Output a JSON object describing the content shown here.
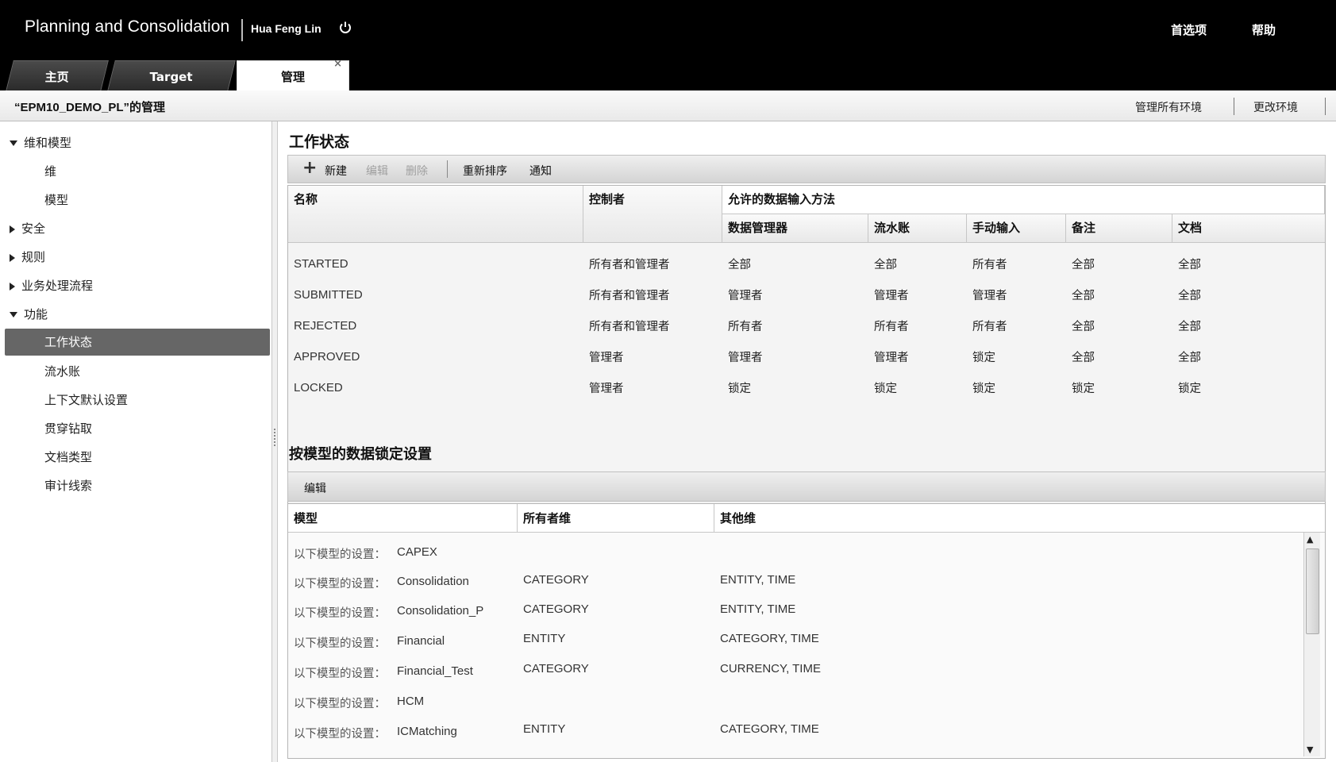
{
  "header": {
    "app_title": "Planning and Consolidation",
    "user": "Hua Feng Lin",
    "links": [
      "首选项",
      "帮助"
    ]
  },
  "tabs": [
    {
      "label": "主页",
      "active": false
    },
    {
      "label": "Target",
      "active": false
    },
    {
      "label": "管理",
      "active": true,
      "close": "×"
    }
  ],
  "subbar": {
    "title": "“EPM10_DEMO_PL”的管理",
    "links": [
      "管理所有环境",
      "更改环境"
    ]
  },
  "sidebar": {
    "items": [
      {
        "label": "维和模型",
        "expand": "down",
        "level": 0
      },
      {
        "label": "维",
        "level": 1
      },
      {
        "label": "模型",
        "level": 1
      },
      {
        "label": "安全",
        "expand": "right",
        "level": 0
      },
      {
        "label": "规则",
        "expand": "right",
        "level": 0
      },
      {
        "label": "业务处理流程",
        "expand": "right",
        "level": 0
      },
      {
        "label": "功能",
        "expand": "down",
        "level": 0
      },
      {
        "label": "工作状态",
        "level": 1,
        "selected": true
      },
      {
        "label": "流水账",
        "level": 1
      },
      {
        "label": "上下文默认设置",
        "level": 1
      },
      {
        "label": "贯穿钻取",
        "level": 1
      },
      {
        "label": "文档类型",
        "level": 1
      },
      {
        "label": "审计线索",
        "level": 1
      }
    ]
  },
  "work_status": {
    "title": "工作状态",
    "toolbar": {
      "new": "新建",
      "edit": "编辑",
      "delete": "删除",
      "reorder": "重新排序",
      "notify": "通知"
    },
    "headers": {
      "name": "名称",
      "controller": "控制者",
      "allowed_methods": "允许的数据输入方法",
      "sub": [
        "数据管理器",
        "流水账",
        "手动输入",
        "备注",
        "文档"
      ]
    },
    "rows": [
      {
        "name": "STARTED",
        "controller": "所有者和管理者",
        "values": [
          "全部",
          "全部",
          "所有者",
          "全部",
          "全部"
        ]
      },
      {
        "name": "SUBMITTED",
        "controller": "所有者和管理者",
        "values": [
          "管理者",
          "管理者",
          "管理者",
          "全部",
          "全部"
        ]
      },
      {
        "name": "REJECTED",
        "controller": "所有者和管理者",
        "values": [
          "所有者",
          "所有者",
          "所有者",
          "全部",
          "全部"
        ]
      },
      {
        "name": "APPROVED",
        "controller": "管理者",
        "values": [
          "管理者",
          "管理者",
          "锁定",
          "全部",
          "全部"
        ]
      },
      {
        "name": "LOCKED",
        "controller": "管理者",
        "values": [
          "锁定",
          "锁定",
          "锁定",
          "锁定",
          "锁定"
        ]
      }
    ]
  },
  "data_lock": {
    "title": "按模型的数据锁定设置",
    "toolbar": {
      "edit": "编辑"
    },
    "headers": [
      "模型",
      "所有者维",
      "其他维"
    ],
    "rows": [
      {
        "prefix": "以下模型的设置：",
        "model": "CAPEX",
        "owner": "",
        "other": ""
      },
      {
        "prefix": "以下模型的设置：",
        "model": "Consolidation",
        "owner": "CATEGORY",
        "other": "ENTITY, TIME"
      },
      {
        "prefix": "以下模型的设置：",
        "model": "Consolidation_P",
        "owner": "CATEGORY",
        "other": "ENTITY, TIME"
      },
      {
        "prefix": "以下模型的设置：",
        "model": "Financial",
        "owner": "ENTITY",
        "other": "CATEGORY, TIME"
      },
      {
        "prefix": "以下模型的设置：",
        "model": "Financial_Test",
        "owner": "CATEGORY",
        "other": "CURRENCY, TIME"
      },
      {
        "prefix": "以下模型的设置：",
        "model": "HCM",
        "owner": "",
        "other": ""
      },
      {
        "prefix": "以下模型的设置：",
        "model": "ICMatching",
        "owner": "ENTITY",
        "other": "CATEGORY, TIME"
      }
    ]
  }
}
